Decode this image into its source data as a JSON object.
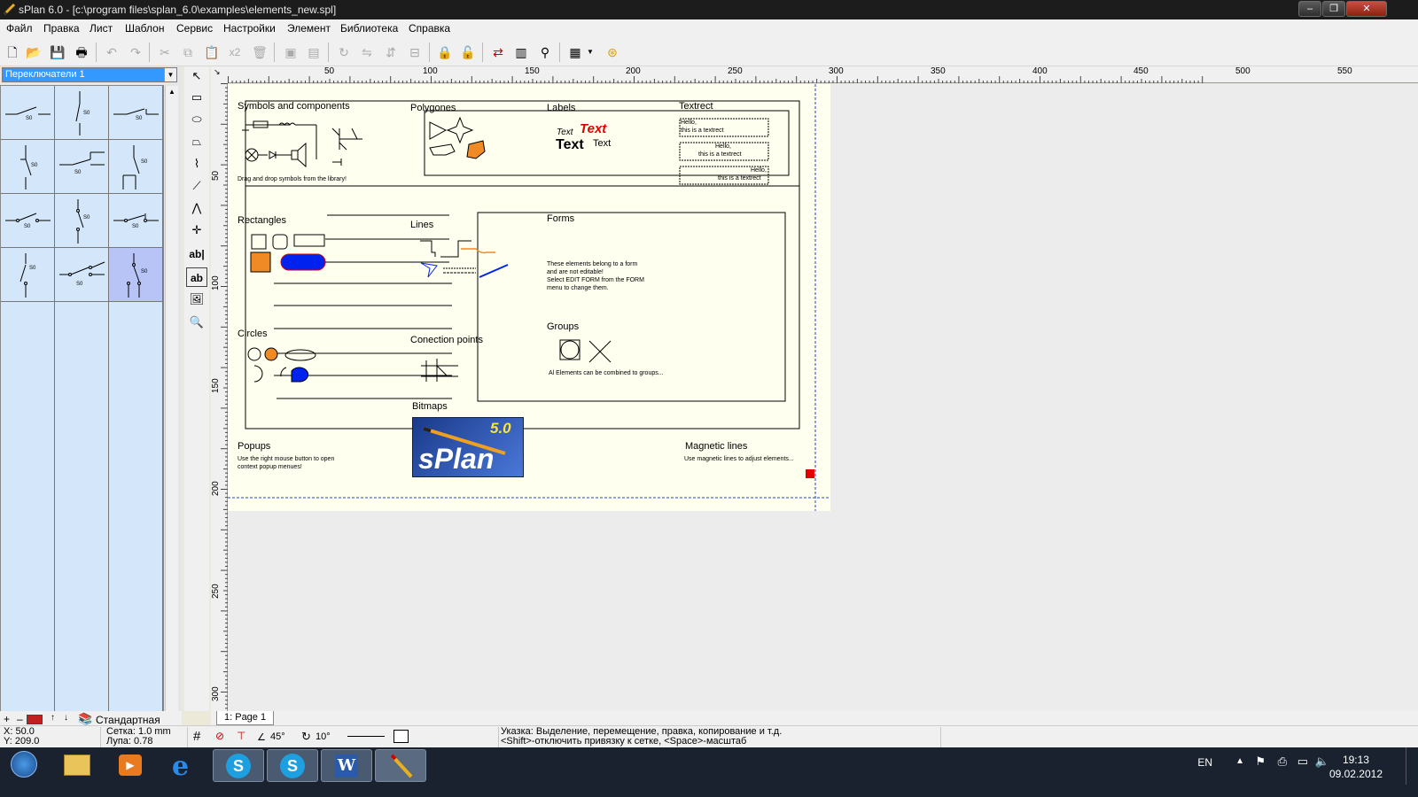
{
  "window": {
    "title": "sPlan 6.0 - [c:\\program files\\splan_6.0\\examples\\elements_new.spl]",
    "buttons": [
      "–",
      "❐",
      "✕"
    ]
  },
  "menu": [
    "Файл",
    "Правка",
    "Лист",
    "Шаблон",
    "Сервис",
    "Настройки",
    "Элемент",
    "Библиотека",
    "Справка"
  ],
  "toolbar": {
    "x2_label": "x2"
  },
  "library": {
    "selected": "Переключатели 1",
    "symbol_label": "S0",
    "bottom_label": "Стандартная"
  },
  "tools": {
    "text_label": "ab|",
    "textbox_label": "ab"
  },
  "ruler": {
    "top": [
      "50",
      "100",
      "150",
      "200",
      "250",
      "300",
      "350",
      "400",
      "450",
      "500",
      "550"
    ],
    "left": [
      "50",
      "100",
      "150",
      "200",
      "250",
      "300"
    ]
  },
  "sheet": {
    "symbols": {
      "title": "Symbols and components",
      "hint": "Drag and drop symbols from the library!"
    },
    "polygones": "Polygones",
    "labels": {
      "title": "Labels",
      "t1": "Text",
      "t2": "Text",
      "t3": "Text",
      "t4": "Text"
    },
    "textrect": {
      "title": "Textrect",
      "line1": "Hello,",
      "line2": "this is a textrect"
    },
    "rectangles": "Rectangles",
    "lines": "Lines",
    "forms": {
      "title": "Forms",
      "text": [
        "These elements belong to a form",
        "and are not editable!",
        "Select EDIT FORM from the FORM",
        "menu to change them."
      ]
    },
    "groups": {
      "title": "Groups",
      "text": "Al Elements can be combined to groups..."
    },
    "circles": "Circles",
    "connection": "Conection points",
    "bitmaps": "Bitmaps",
    "logo": {
      "version": "5.0",
      "name": "sPlan"
    },
    "popups": {
      "title": "Popups",
      "line1": "Use the right mouse button to open",
      "line2": "context popup menues!"
    },
    "magnetic": {
      "title": "Magnetic lines",
      "text": "Use magnetic lines to adjust elements..."
    }
  },
  "tab": "1: Page 1",
  "status": {
    "x": "X: 50.0",
    "y": "Y: 209.0",
    "grid": "Сетка:   1.0 mm",
    "zoom": "Лупа:   0.78",
    "angle": "45°",
    "rotate": "10°",
    "hint1": "Указка: Выделение, перемещение, правка, копирование и т.д.",
    "hint2": "<Shift>-отключить привязку к сетке, <Space>-масштаб"
  },
  "taskbar": {
    "lang": "EN",
    "time": "19:13",
    "date": "09.02.2012"
  },
  "colors": {
    "accent_red": "#e00000",
    "orange": "#f08a24",
    "blue": "#0022ee",
    "guide": "#2244cc"
  }
}
